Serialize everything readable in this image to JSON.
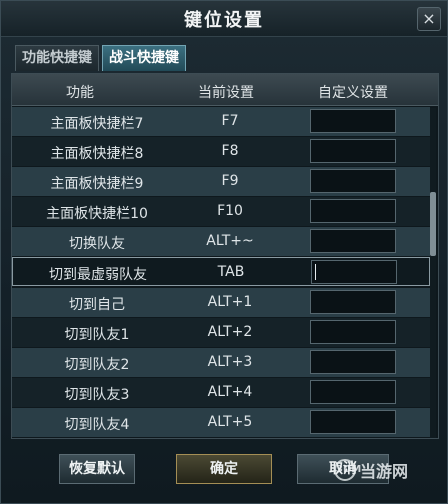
{
  "window": {
    "title": "键位设置",
    "close_glyph": "×"
  },
  "tabs": [
    {
      "label": "功能快捷键",
      "active": false
    },
    {
      "label": "战斗快捷键",
      "active": true
    }
  ],
  "table": {
    "headers": [
      "功能",
      "当前设置",
      "自定义设置"
    ],
    "rows": [
      {
        "function": "主面板快捷栏7",
        "current": "F7",
        "custom": ""
      },
      {
        "function": "主面板快捷栏8",
        "current": "F8",
        "custom": ""
      },
      {
        "function": "主面板快捷栏9",
        "current": "F9",
        "custom": ""
      },
      {
        "function": "主面板快捷栏10",
        "current": "F10",
        "custom": ""
      },
      {
        "function": "切换队友",
        "current": "ALT+~",
        "custom": ""
      },
      {
        "function": "切到最虚弱队友",
        "current": "TAB",
        "custom": "",
        "selected": true
      },
      {
        "function": "切到自己",
        "current": "ALT+1",
        "custom": ""
      },
      {
        "function": "切到队友1",
        "current": "ALT+2",
        "custom": ""
      },
      {
        "function": "切到队友2",
        "current": "ALT+3",
        "custom": ""
      },
      {
        "function": "切到队友3",
        "current": "ALT+4",
        "custom": ""
      },
      {
        "function": "切到队友4",
        "current": "ALT+5",
        "custom": ""
      }
    ]
  },
  "buttons": {
    "restore_default": "恢复默认",
    "confirm": "确定",
    "cancel": "取消"
  },
  "watermark": {
    "logo_text": "3DM",
    "text": "当游网"
  }
}
